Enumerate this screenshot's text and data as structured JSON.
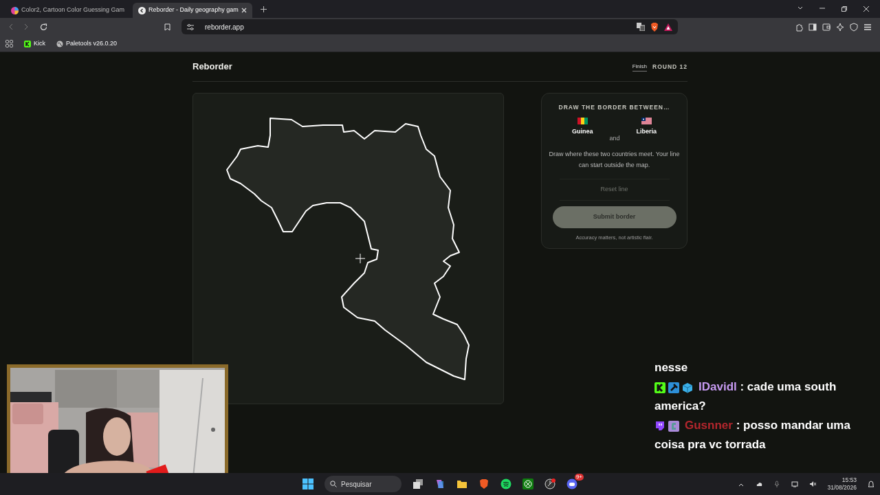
{
  "browser": {
    "tabs": [
      {
        "title": "Color2, Cartoon Color Guessing Gam",
        "selected": false
      },
      {
        "title": "Reborder - Daily geography gam",
        "selected": true
      }
    ],
    "url": "reborder.app",
    "bookmarks": [
      {
        "label": "Kick"
      },
      {
        "label": "Paletools v26.0.20"
      }
    ]
  },
  "app": {
    "title": "Reborder",
    "finish_link": "Finish",
    "round": "ROUND 12"
  },
  "panel": {
    "heading": "DRAW THE BORDER BETWEEN…",
    "countries": [
      {
        "name": "Guinea"
      },
      {
        "name": "Liberia"
      }
    ],
    "joiner": "and",
    "instructions": "Draw where these two countries meet. Your line can start outside the map.",
    "reset_button": "Reset line",
    "submit_button": "Submit border",
    "note": "Accuracy matters, not artistic flair."
  },
  "chat": {
    "messages": [
      {
        "kind": "continuation",
        "text": "nesse"
      },
      {
        "kind": "message",
        "user": "IDavidl",
        "color": "#c79bf2",
        "text": ": cade uma south america?"
      },
      {
        "kind": "message",
        "user": "Gusnner",
        "color": "#b3262d",
        "text": ": posso mandar uma coisa pra vc torrada"
      }
    ]
  },
  "taskbar": {
    "search_placeholder": "Pesquisar",
    "discord_badge": "9+",
    "time": "15:53",
    "date": "31/08/2026"
  }
}
